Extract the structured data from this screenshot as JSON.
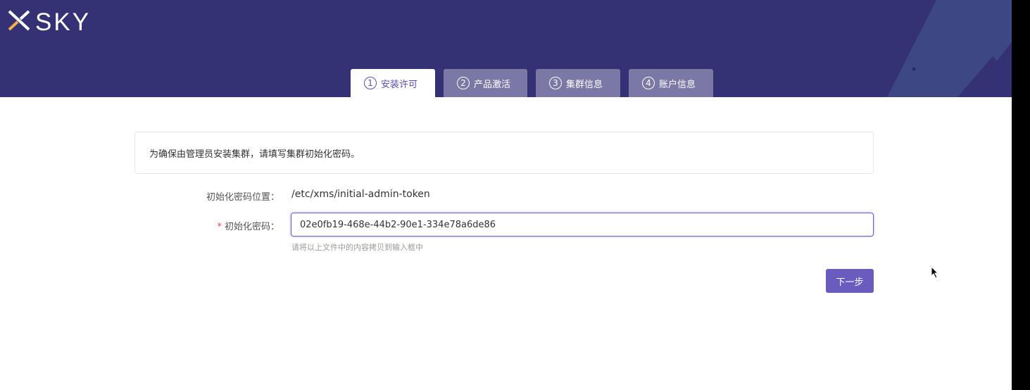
{
  "brand": {
    "logo_text": "SKY",
    "accent_color": "#f2b04a",
    "header_color": "#343174"
  },
  "steps": [
    {
      "number": "1",
      "label": "安装许可",
      "active": true
    },
    {
      "number": "2",
      "label": "产品激活",
      "active": false
    },
    {
      "number": "3",
      "label": "集群信息",
      "active": false
    },
    {
      "number": "4",
      "label": "账户信息",
      "active": false
    }
  ],
  "notice": {
    "text": "为确保由管理员安装集群，请填写集群初始化密码。"
  },
  "form": {
    "location_label": "初始化密码位置：",
    "location_value": "/etc/xms/initial-admin-token",
    "required_mark": "*",
    "password_label": "初始化密码：",
    "password_value": "02e0fb19-468e-44b2-90e1-334e78a6de86",
    "hint": "请将以上文件中的内容拷贝到输入框中"
  },
  "actions": {
    "next_label": "下一步",
    "button_color": "#6a5bbf"
  }
}
